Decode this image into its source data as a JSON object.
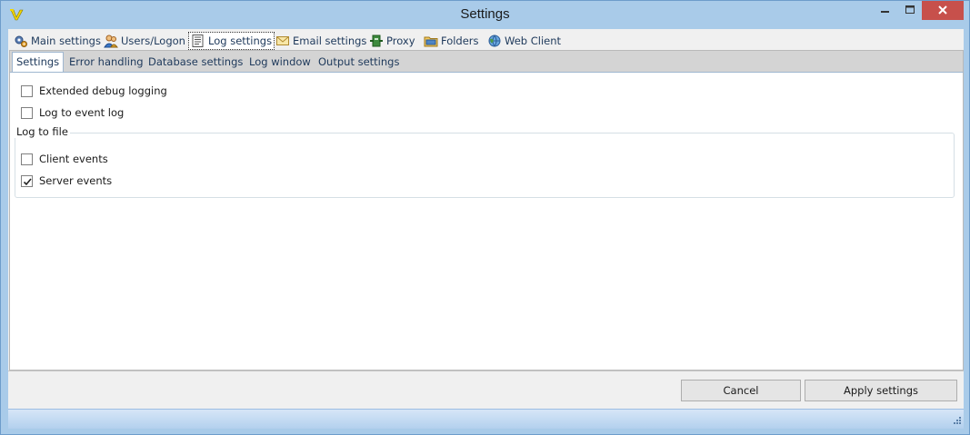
{
  "window": {
    "title": "Settings"
  },
  "main_tabs": [
    {
      "label": "Main settings",
      "icon": "gears-icon"
    },
    {
      "label": "Users/Logon",
      "icon": "users-icon"
    },
    {
      "label": "Log settings",
      "icon": "log-icon",
      "active": true
    },
    {
      "label": "Email settings",
      "icon": "envelope-icon"
    },
    {
      "label": "Proxy",
      "icon": "proxy-icon"
    },
    {
      "label": "Folders",
      "icon": "folders-icon"
    },
    {
      "label": "Web Client",
      "icon": "globe-icon"
    }
  ],
  "sub_tabs": [
    {
      "label": "Settings",
      "active": true
    },
    {
      "label": "Error handling"
    },
    {
      "label": "Database settings"
    },
    {
      "label": "Log window"
    },
    {
      "label": "Output settings"
    }
  ],
  "options": {
    "extended_debug": {
      "label": "Extended debug logging",
      "checked": false
    },
    "event_log": {
      "label": "Log to event log",
      "checked": false
    }
  },
  "log_to_file": {
    "legend": "Log to file",
    "client_events": {
      "label": "Client events",
      "checked": false
    },
    "server_events": {
      "label": "Server events",
      "checked": true
    }
  },
  "buttons": {
    "cancel": "Cancel",
    "apply": "Apply settings"
  },
  "colors": {
    "frame": "#a9cbe9",
    "close_button": "#c7504b",
    "tab_text": "#1e395b"
  }
}
